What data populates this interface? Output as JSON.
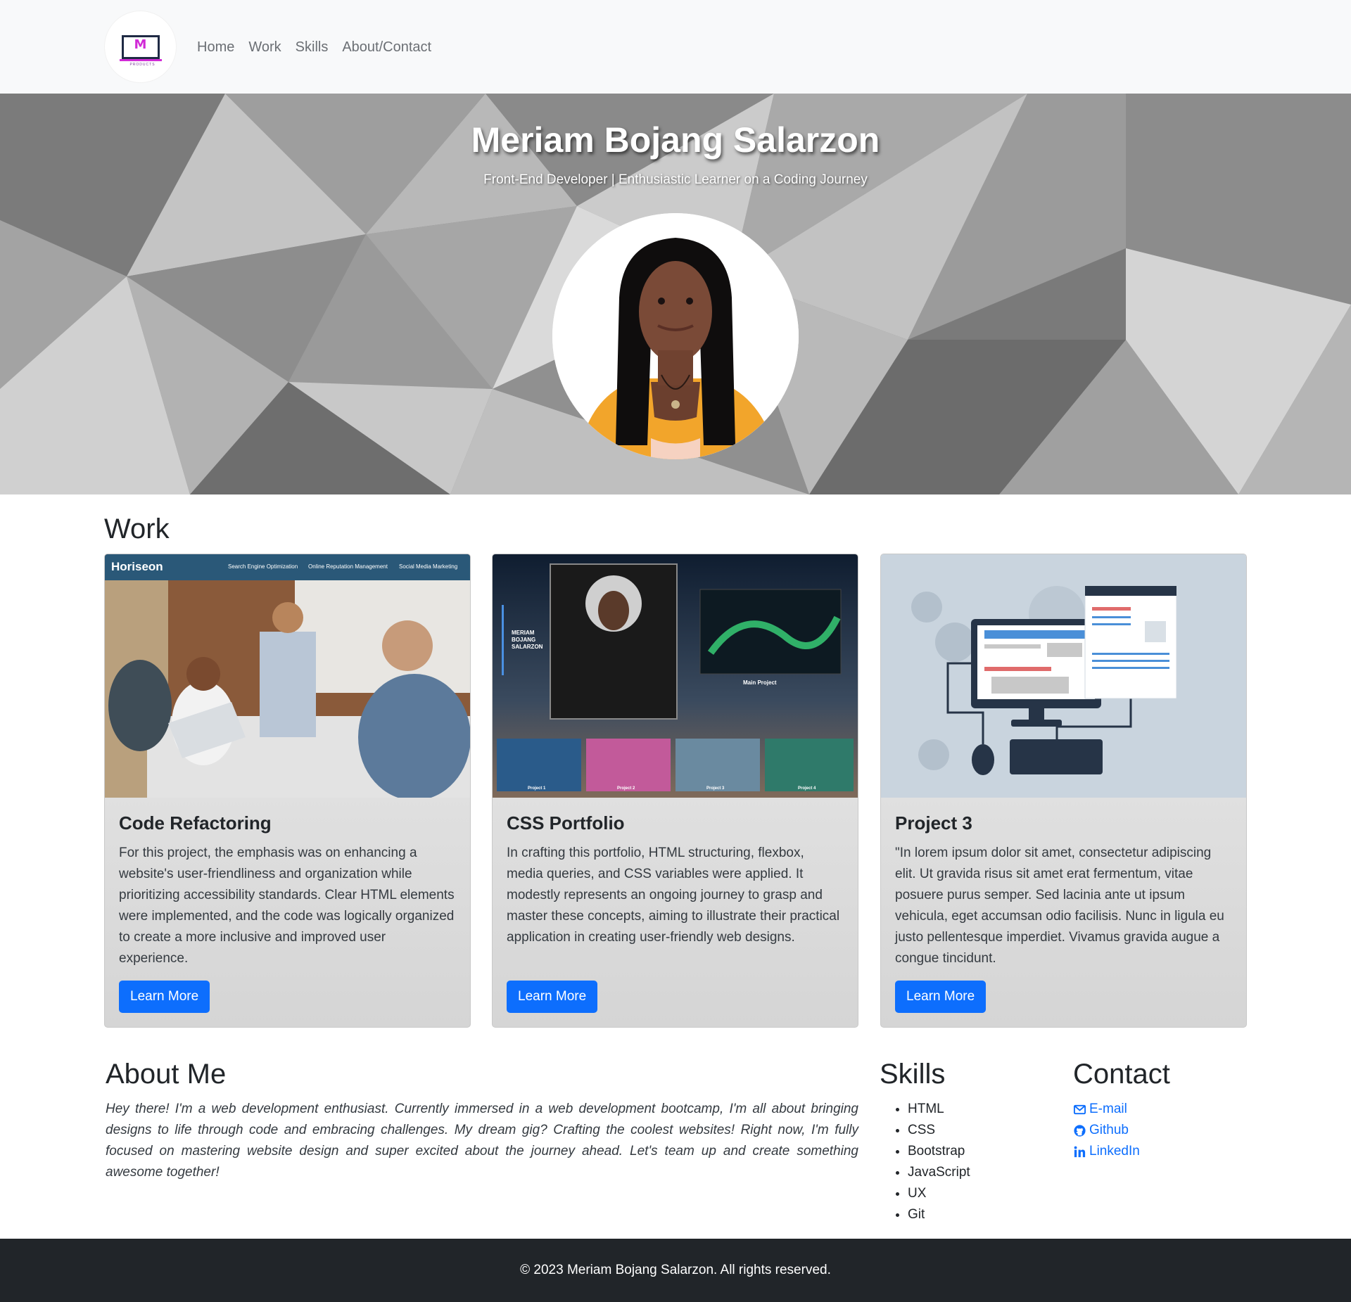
{
  "logo": {
    "letter": "M",
    "tagline": "PRODUCTS"
  },
  "nav": {
    "items": [
      "Home",
      "Work",
      "Skills",
      "About/Contact"
    ]
  },
  "hero": {
    "title": "Meriam Bojang Salarzon",
    "subtitle": "Front-End Developer | Enthusiastic Learner on a Coding Journey"
  },
  "work": {
    "heading": "Work",
    "cards": [
      {
        "title": "Code Refactoring",
        "text": "For this project, the emphasis was on enhancing a website's user-friendliness and organization while prioritizing accessibility standards. Clear HTML elements were implemented, and the code was logically organized to create a more inclusive and improved user experience.",
        "button": "Learn More",
        "image": {
          "brand": "Horiseon",
          "nav": [
            "Search Engine Optimization",
            "Online Reputation Management",
            "Social Media Marketing"
          ]
        }
      },
      {
        "title": "CSS Portfolio",
        "text": "In crafting this portfolio, HTML structuring, flexbox, media queries, and CSS variables were applied. It modestly represents an ongoing journey to grasp and master these concepts, aiming to illustrate their practical application in creating user-friendly web designs.",
        "button": "Learn More",
        "image": {
          "name": "MERIAM BOJANG SALARZON",
          "main": "Main Project",
          "projects": [
            "Project 1",
            "Project 2",
            "Project 3",
            "Project 4"
          ]
        }
      },
      {
        "title": "Project 3",
        "text": "\"In lorem ipsum dolor sit amet, consectetur adipiscing elit. Ut gravida risus sit amet erat fermentum, vitae posuere purus semper. Sed lacinia ante ut ipsum vehicula, eget accumsan odio facilisis. Nunc in ligula eu justo pellentesque imperdiet. Vivamus gravida augue a congue tincidunt.",
        "button": "Learn More"
      }
    ]
  },
  "about": {
    "heading": "About Me",
    "text": "Hey there! I'm a web development enthusiast. Currently immersed in a web development bootcamp, I'm all about bringing designs to life through code and embracing challenges. My dream gig? Crafting the coolest websites! Right now, I'm fully focused on mastering website design and super excited about the journey ahead. Let's team up and create something awesome together!"
  },
  "skills": {
    "heading": "Skills",
    "items": [
      "HTML",
      "CSS",
      "Bootstrap",
      "JavaScript",
      "UX",
      "Git"
    ]
  },
  "contact": {
    "heading": "Contact",
    "links": [
      {
        "label": "E-mail",
        "icon": "envelope-icon"
      },
      {
        "label": "Github",
        "icon": "github-icon"
      },
      {
        "label": "LinkedIn",
        "icon": "linkedin-icon"
      }
    ]
  },
  "footer": {
    "text": "© 2023 Meriam Bojang Salarzon. All rights reserved."
  },
  "colors": {
    "primary": "#0d6efd",
    "navbar": "#f8f9fa",
    "footer": "#212529",
    "logo_accent": "#d12bd6"
  }
}
